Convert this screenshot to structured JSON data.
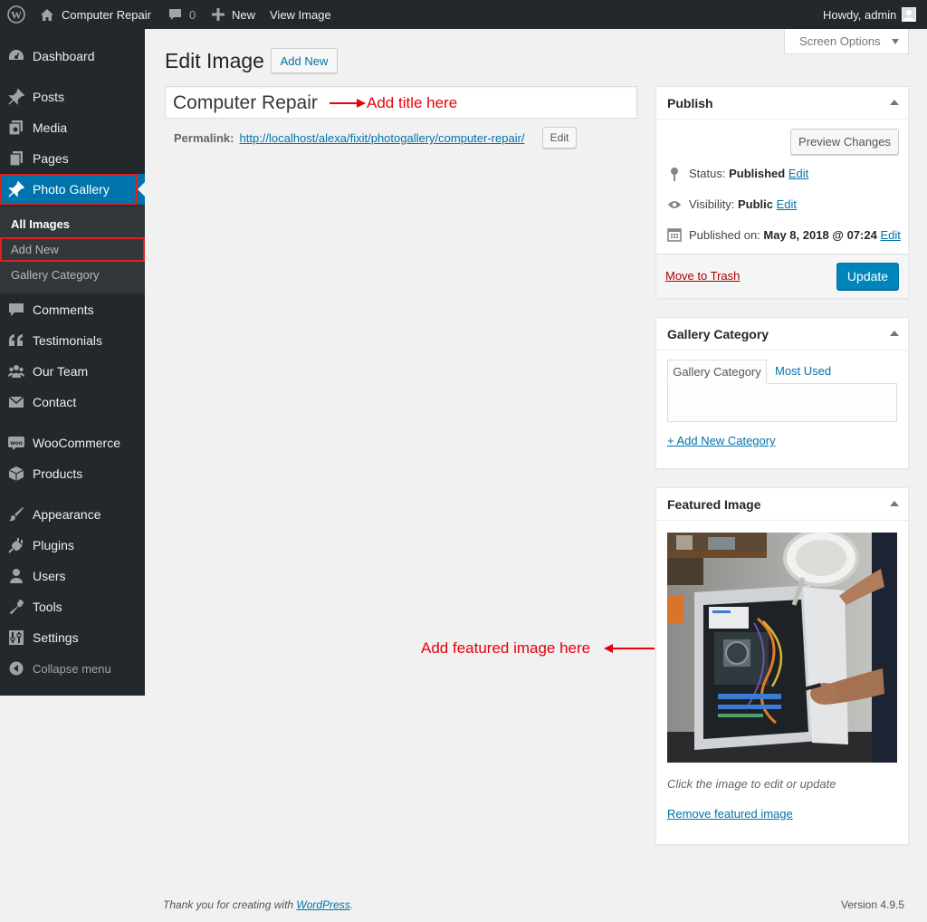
{
  "adminbar": {
    "site_name": "Computer Repair",
    "comments_count": "0",
    "new_label": "New",
    "view_label": "View Image",
    "greeting": "Howdy, admin"
  },
  "sidebar": {
    "items": [
      {
        "label": "Dashboard",
        "icon": "dashboard-icon"
      },
      {
        "label": "Posts",
        "icon": "pin-icon"
      },
      {
        "label": "Media",
        "icon": "media-icon"
      },
      {
        "label": "Pages",
        "icon": "pages-icon"
      },
      {
        "label": "Photo Gallery",
        "icon": "pin-icon"
      },
      {
        "label": "Comments",
        "icon": "comment-icon"
      },
      {
        "label": "Testimonials",
        "icon": "quote-icon"
      },
      {
        "label": "Our Team",
        "icon": "team-icon"
      },
      {
        "label": "Contact",
        "icon": "mail-icon"
      },
      {
        "label": "WooCommerce",
        "icon": "woo-icon"
      },
      {
        "label": "Products",
        "icon": "box-icon"
      },
      {
        "label": "Appearance",
        "icon": "brush-icon"
      },
      {
        "label": "Plugins",
        "icon": "plugin-icon"
      },
      {
        "label": "Users",
        "icon": "user-icon"
      },
      {
        "label": "Tools",
        "icon": "wrench-icon"
      },
      {
        "label": "Settings",
        "icon": "settings-icon"
      },
      {
        "label": "Collapse menu",
        "icon": "collapse-icon"
      }
    ],
    "submenu": [
      "All Images",
      "Add New",
      "Gallery Category"
    ]
  },
  "screen_options": "Screen Options",
  "page": {
    "title": "Edit Image",
    "add_new": "Add New",
    "post_title": "Computer Repair",
    "title_annotation": "Add title here",
    "permalink_label": "Permalink:",
    "permalink_url": "http://localhost/alexa/fixit/photogallery/computer-repair/",
    "permalink_edit": "Edit",
    "featured_annotation": "Add featured image here"
  },
  "publish": {
    "title": "Publish",
    "preview": "Preview Changes",
    "status_label": "Status:",
    "status_value": "Published",
    "visibility_label": "Visibility:",
    "visibility_value": "Public",
    "published_label": "Published on:",
    "published_value": "May 8, 2018 @ 07:24",
    "edit": "Edit",
    "trash": "Move to Trash",
    "update": "Update"
  },
  "category": {
    "title": "Gallery Category",
    "tab_all": "Gallery Category",
    "tab_used": "Most Used",
    "add_new": "+ Add New Category"
  },
  "featured": {
    "title": "Featured Image",
    "hint": "Click the image to edit or update",
    "remove": "Remove featured image"
  },
  "footer": {
    "thanks": "Thank you for creating with ",
    "wp_link": "WordPress",
    "period": ".",
    "version": "Version 4.9.5"
  },
  "colors": {
    "adminbar": "#23282d",
    "accent": "#0073aa",
    "annotation": "#e8000b"
  }
}
